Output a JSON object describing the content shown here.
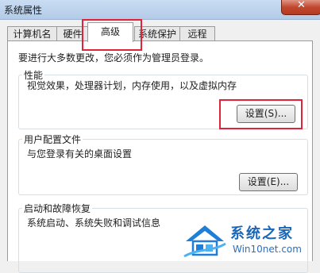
{
  "window": {
    "title": "系统属性",
    "close_label": "✕"
  },
  "tabs": [
    {
      "label": "计算机名",
      "active": false
    },
    {
      "label": "硬件",
      "active": false
    },
    {
      "label": "高级",
      "active": true
    },
    {
      "label": "系统保护",
      "active": false
    },
    {
      "label": "远程",
      "active": false
    }
  ],
  "advanced": {
    "admin_note": "要进行大多数更改，您必须作为管理员登录。",
    "performance": {
      "title": "性能",
      "description": "视觉效果，处理器计划，内存使用，以及虚拟内存",
      "button_label": "设置(S)..."
    },
    "user_profiles": {
      "title": "用户配置文件",
      "description": "与您登录有关的桌面设置",
      "button_label": "设置(E)..."
    },
    "startup_recovery": {
      "title": "启动和故障恢复",
      "description": "系统启动、系统失败和调试信息"
    }
  },
  "watermark": {
    "brand": "系统之家",
    "url": "Win10net.com"
  },
  "colors": {
    "highlight": "#e0223a",
    "titlebar": "#c9dcf2",
    "close_button": "#c0482f"
  }
}
